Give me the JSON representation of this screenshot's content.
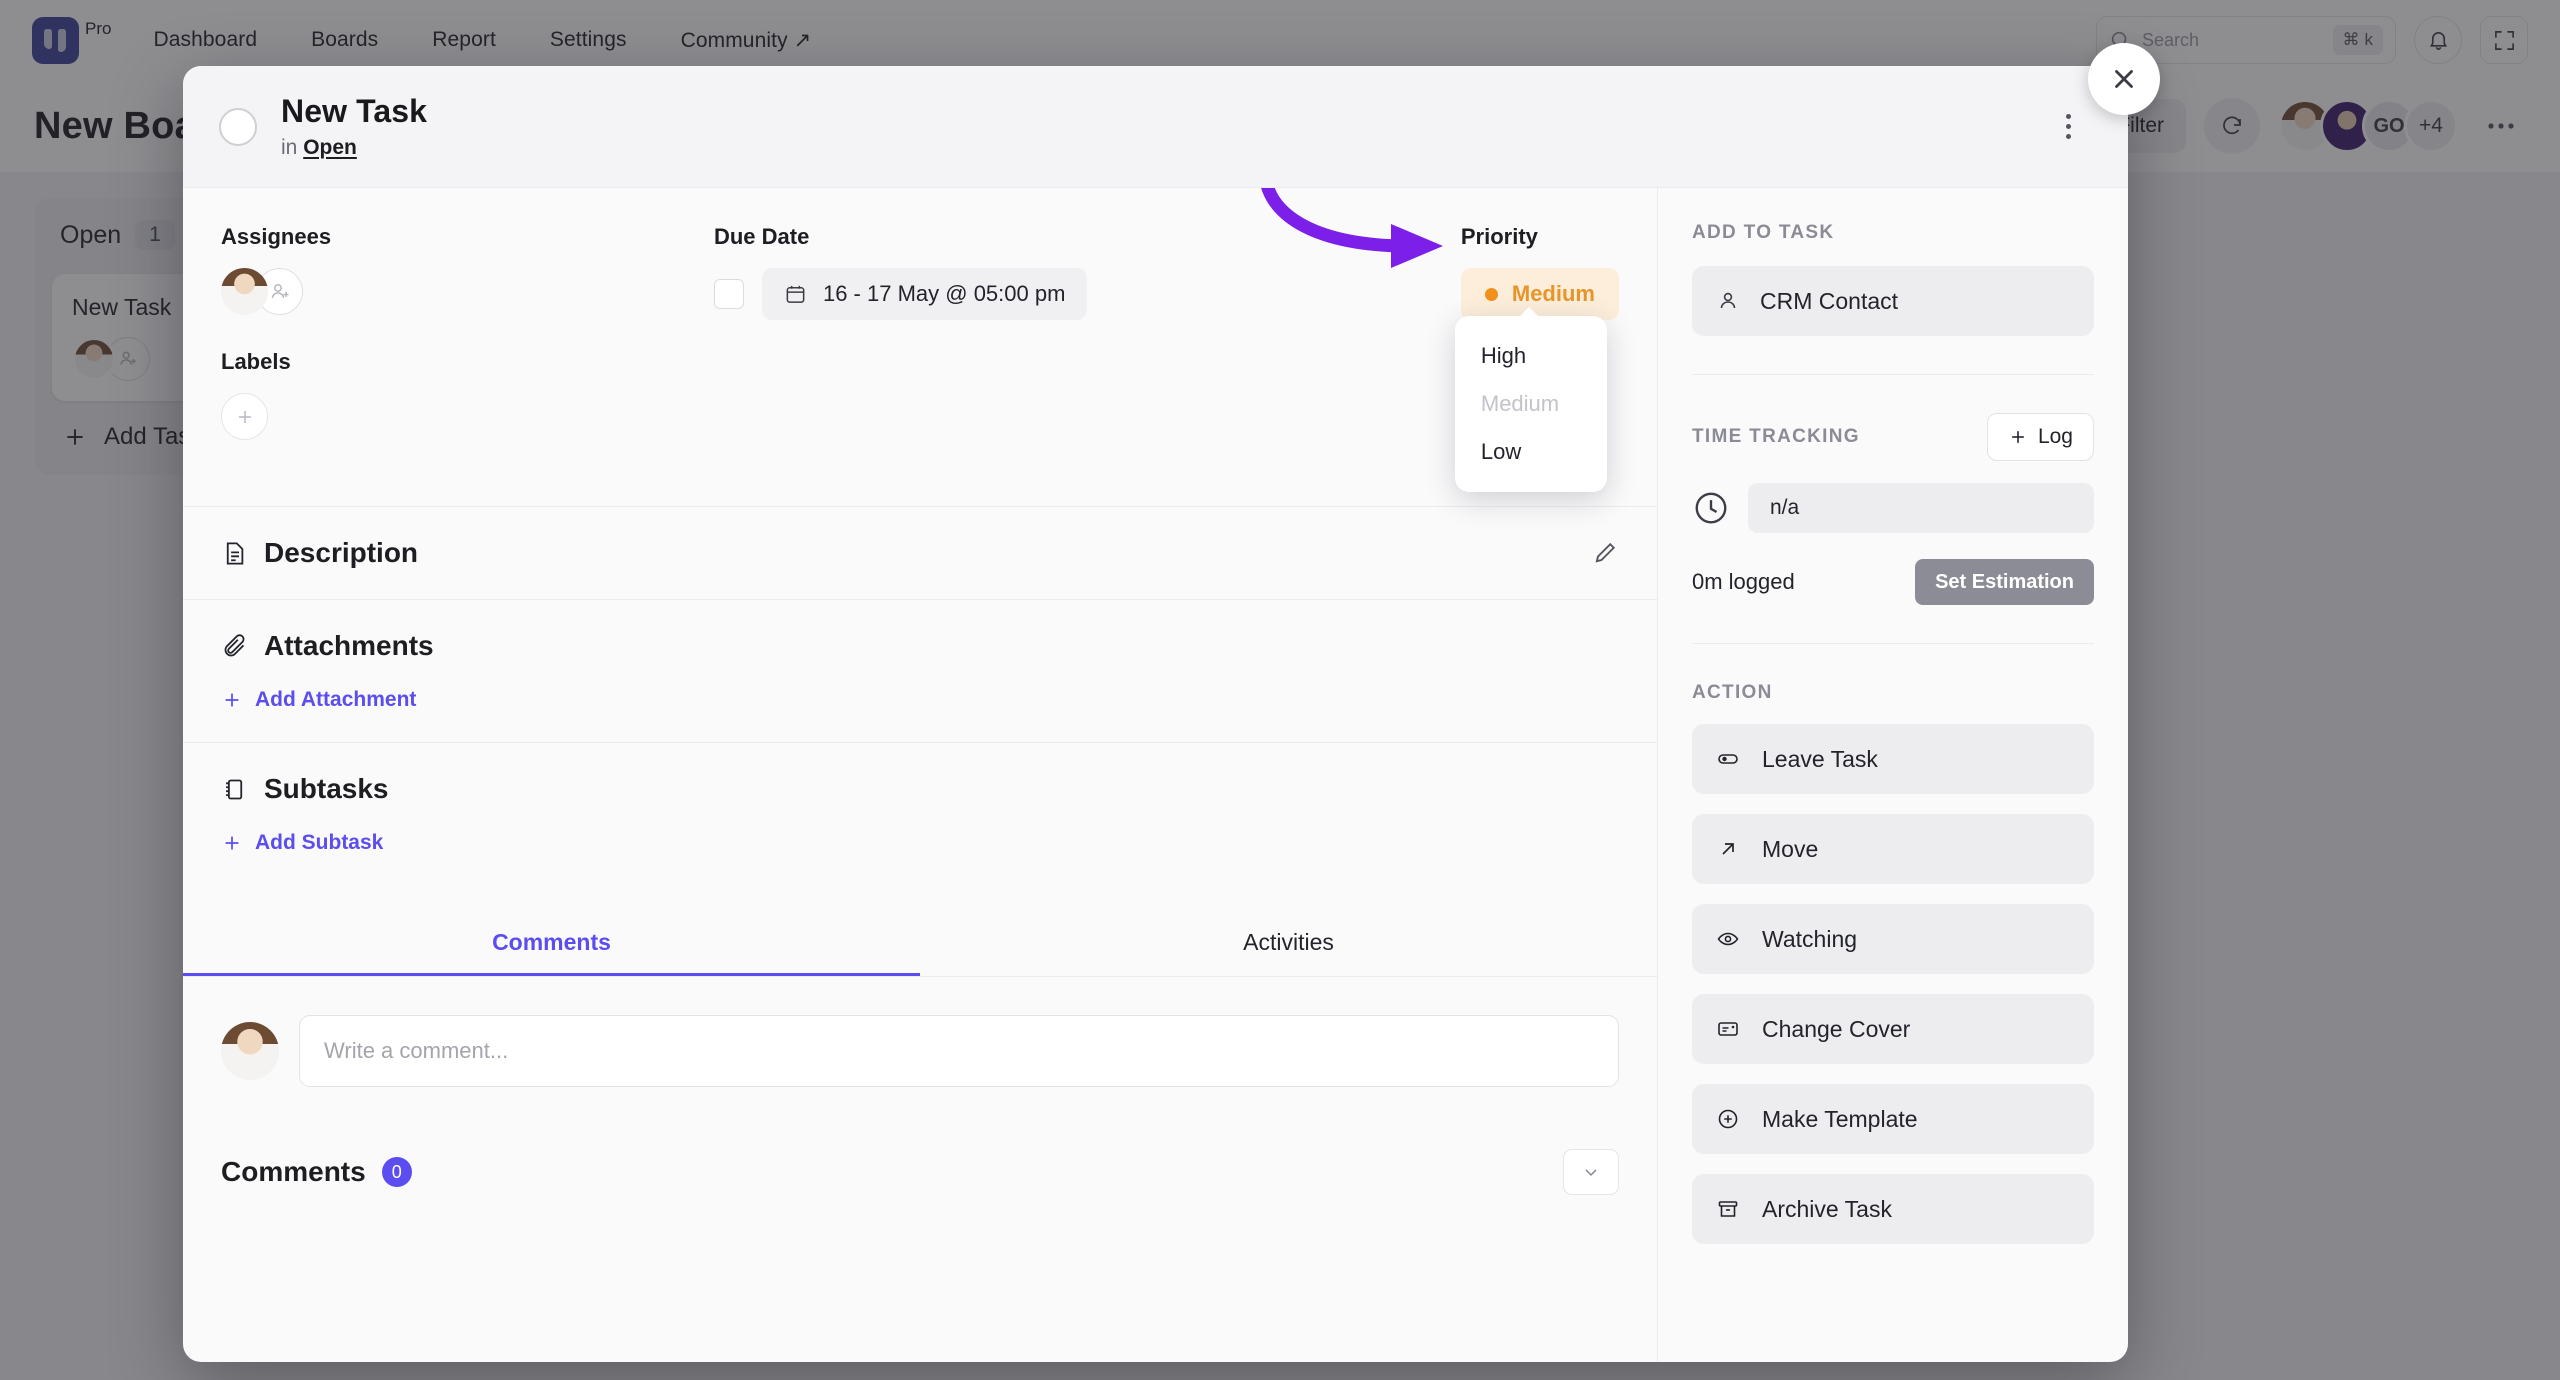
{
  "topnav": {
    "logo_badge": "Pro",
    "items": [
      {
        "label": "Dashboard"
      },
      {
        "label": "Boards"
      },
      {
        "label": "Report"
      },
      {
        "label": "Settings"
      },
      {
        "label": "Community ↗"
      }
    ],
    "search_placeholder": "Search",
    "search_shortcut_modifier": "⌘",
    "search_shortcut_key": "k",
    "bell_icon": "bell-icon",
    "fullscreen_icon": "fullscreen-icon"
  },
  "board": {
    "title": "New Board",
    "filter_label": "Filter",
    "refresh_icon": "refresh-icon",
    "avatar_initials": "GO",
    "avatar_overflow": "+4",
    "more_icon": "more-horizontal-icon",
    "column": {
      "name": "Open",
      "count": "1",
      "card_title": "New Task",
      "add_task_label": "Add Task"
    }
  },
  "modal": {
    "title": "New Task",
    "in_word": "in",
    "status_link": "Open",
    "kebab_icon": "more-vertical-icon",
    "close_icon": "close-icon",
    "meta": {
      "assignees_label": "Assignees",
      "add_person_icon": "add-person-icon",
      "labels_label": "Labels",
      "add_label_icon": "plus-icon",
      "due_date_label": "Due Date",
      "due_date_value": "16 - 17 May @ 05:00 pm",
      "calendar_icon": "calendar-icon",
      "priority_label": "Priority",
      "priority_value": "Medium",
      "priority_color": "#e8952a",
      "priority_bg": "#fdeedb",
      "priority_options": [
        {
          "label": "High",
          "state": "enabled"
        },
        {
          "label": "Medium",
          "state": "selected-disabled"
        },
        {
          "label": "Low",
          "state": "enabled"
        }
      ],
      "annotation_arrow_color": "#7c1fe8"
    },
    "description": {
      "title": "Description",
      "icon": "document-icon",
      "edit_icon": "pencil-icon"
    },
    "attachments": {
      "title": "Attachments",
      "icon": "paperclip-icon",
      "add_label": "Add Attachment"
    },
    "subtasks": {
      "title": "Subtasks",
      "icon": "subtask-icon",
      "add_label": "Add Subtask"
    },
    "tabs": [
      {
        "label": "Comments",
        "active": true
      },
      {
        "label": "Activities",
        "active": false
      }
    ],
    "comment_placeholder": "Write a comment...",
    "comments_heading": "Comments",
    "comments_count": "0",
    "collapse_icon": "chevron-down-icon",
    "sidebar": {
      "add_to_task_label": "ADD TO TASK",
      "crm_contact_label": "CRM Contact",
      "crm_icon": "person-icon",
      "time_tracking_label": "TIME TRACKING",
      "log_label": "Log",
      "clock_icon": "clock-icon",
      "time_value": "n/a",
      "logged_text": "0m logged",
      "set_estimation_label": "Set Estimation",
      "action_label": "ACTION",
      "actions": [
        {
          "label": "Leave Task",
          "icon": "leave-icon"
        },
        {
          "label": "Move",
          "icon": "arrow-up-right-icon"
        },
        {
          "label": "Watching",
          "icon": "eye-icon"
        },
        {
          "label": "Change Cover",
          "icon": "image-icon"
        },
        {
          "label": "Make Template",
          "icon": "plus-circle-icon"
        },
        {
          "label": "Archive Task",
          "icon": "archive-icon"
        }
      ]
    }
  }
}
